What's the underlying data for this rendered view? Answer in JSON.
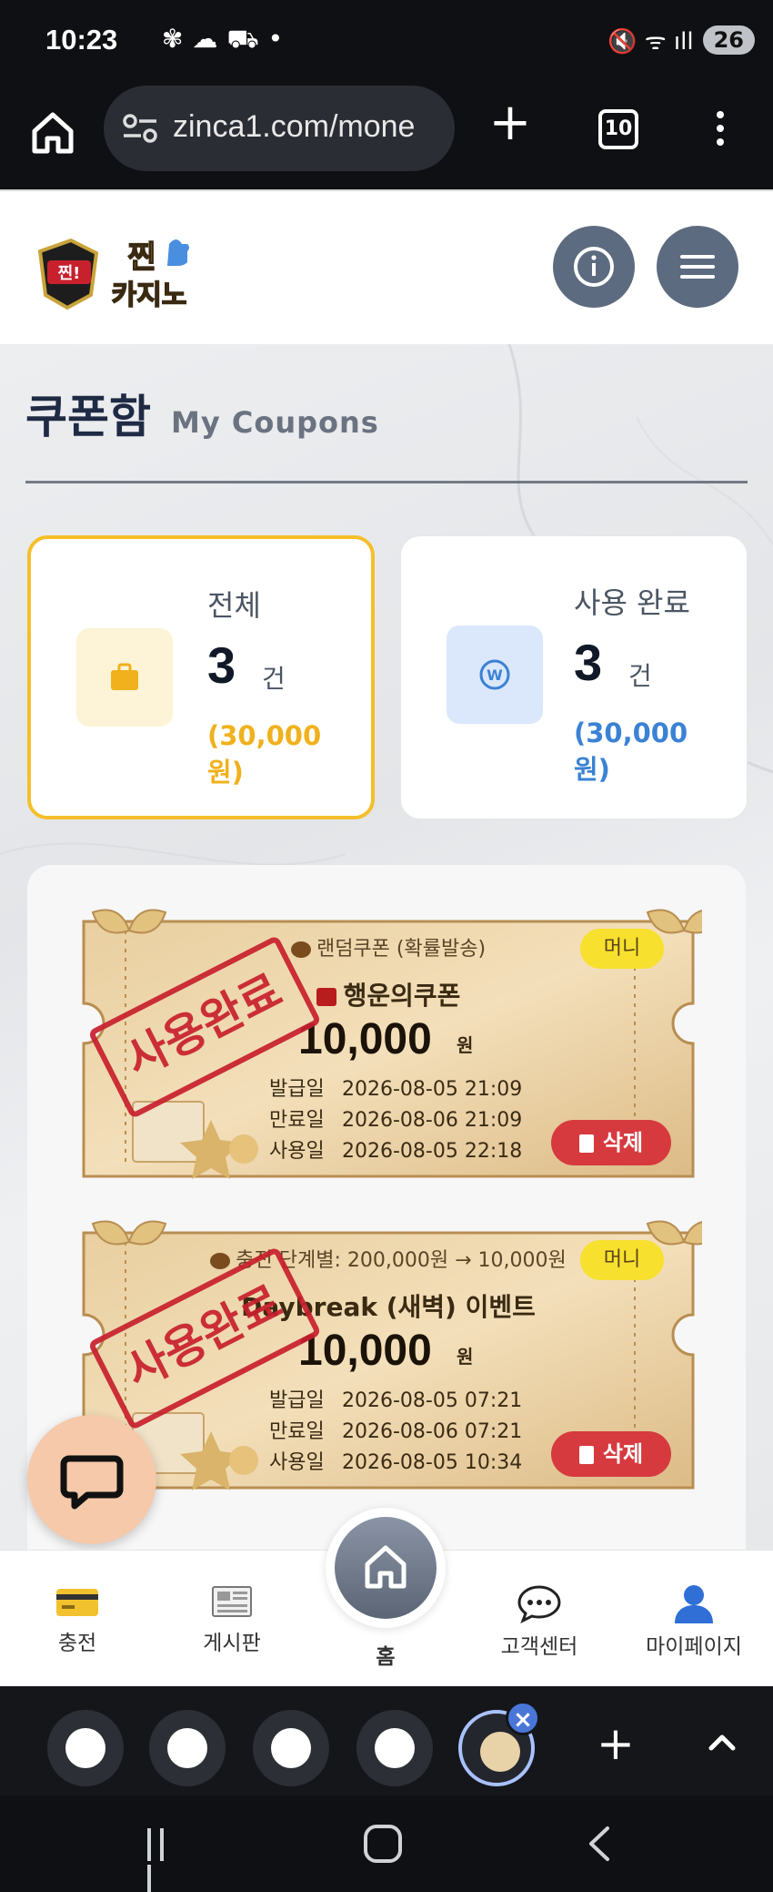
{
  "status_bar": {
    "time": "10:23",
    "notif_icons": "✾☁⛟•",
    "battery": "26",
    "right_icons": "🔇 ᯤ ıll"
  },
  "browser": {
    "url": "zinca1.com/mone",
    "tab_count": "10"
  },
  "page": {
    "title": "쿠폰함",
    "subtitle": "My Coupons"
  },
  "stats": {
    "total": {
      "label": "전체",
      "count": "3",
      "unit": "건",
      "amount": "(30,000 원)"
    },
    "used": {
      "label": "사용 완료",
      "count": "3",
      "unit": "건",
      "amount": "(30,000 원)"
    }
  },
  "coupons": [
    {
      "type": "랜덤쿠폰 (확률발송)",
      "badge": "머니",
      "name": "행운의쿠폰",
      "amount": "10,000",
      "won": "원",
      "issued_label": "발급일",
      "issued": "2026-08-05 21:09",
      "expires_label": "만료일",
      "expires": "2026-08-06 21:09",
      "used_label": "사용일",
      "used": "2026-08-05 22:18",
      "delete_label": "삭제",
      "stamp": "사용완료"
    },
    {
      "type": "충전 단계별: 200,000원 → 10,000원",
      "badge": "머니",
      "name": "Daybreak (새벽) 이벤트",
      "amount": "10,000",
      "won": "원",
      "issued_label": "발급일",
      "issued": "2026-08-05 07:21",
      "expires_label": "만료일",
      "expires": "2026-08-06 07:21",
      "used_label": "사용일",
      "used": "2026-08-05 10:34",
      "delete_label": "삭제",
      "stamp": "사용완료"
    }
  ],
  "bottom_nav": {
    "charge": "충전",
    "board": "게시판",
    "home": "홈",
    "support": "고객센터",
    "mypage": "마이페이지"
  },
  "colors": {
    "accent_yellow": "#f5bf2a",
    "accent_blue": "#3b82d4",
    "delete_red": "#d63a3f",
    "stamp_red": "#c8202d",
    "nav_slate": "#5d6b80"
  }
}
